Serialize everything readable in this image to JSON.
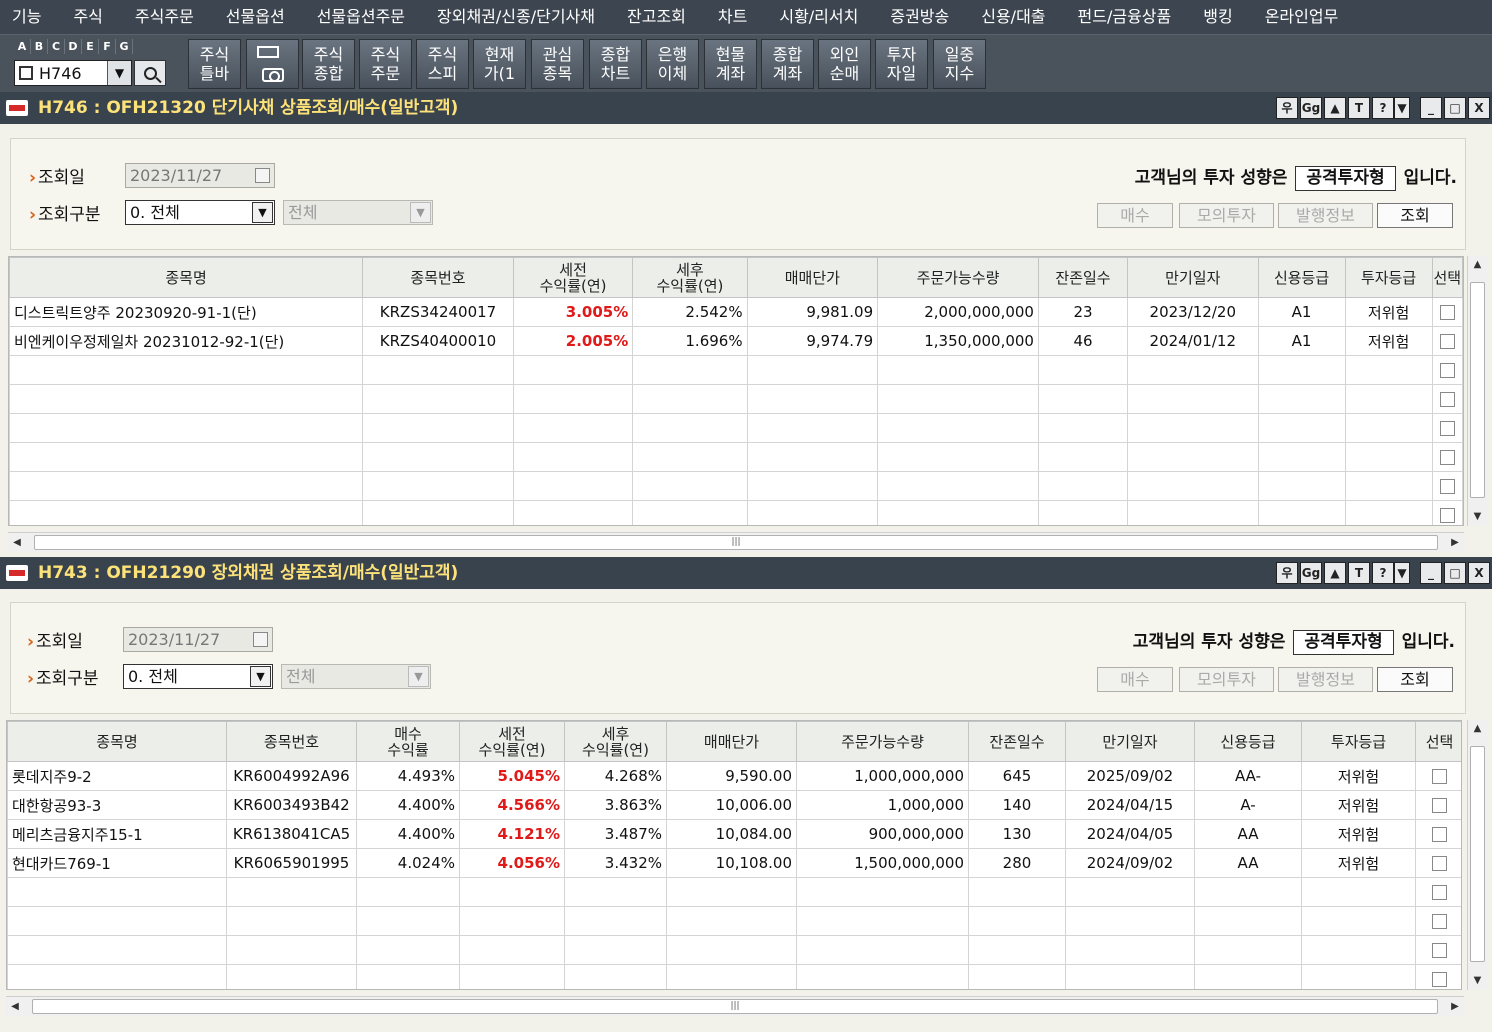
{
  "menu": [
    "기능",
    "주식",
    "주식주문",
    "선물옵션",
    "선물옵션주문",
    "장외채권/신종/단기사채",
    "잔고조회",
    "차트",
    "시황/리서치",
    "증권방송",
    "신용/대출",
    "펀드/금융상품",
    "뱅킹",
    "온라인업무"
  ],
  "toolbar": {
    "letters": [
      "A",
      "B",
      "C",
      "D",
      "E",
      "F",
      "G"
    ],
    "code": "H746",
    "buttons": [
      "주식\n틀바",
      "주식\n종합",
      "주식\n주문",
      "주식\n스피",
      "현재\n가(1",
      "관심\n종목",
      "종합\n차트",
      "은행\n이체",
      "현물\n계좌",
      "종합\n계좌",
      "외인\n순매",
      "투자\n자일",
      "일중\n지수"
    ]
  },
  "window_controls": [
    "우",
    "Gg",
    "▲",
    "T",
    "?",
    "▼",
    "_",
    "□",
    "X"
  ],
  "colors": {
    "menubar": "#3d4650",
    "title_text": "#fde27a",
    "highlight_red": "#e01919",
    "label_arrow": "#d9621a"
  },
  "win1": {
    "title": "H746 : OFH21320 단기사채 상품조회/매수(일반고객)",
    "query_date_label": "조회일",
    "query_date": "2023/11/27",
    "query_type_label": "조회구분",
    "query_type": "0. 전체",
    "query_sub": "전체",
    "invest_prefix": "고객님의 투자 성향은",
    "invest_type": "공격투자형",
    "invest_suffix": "입니다.",
    "buttons": [
      "매수",
      "모의투자",
      "발행정보",
      "조회"
    ],
    "headers": [
      "종목명",
      "종목번호",
      "세전\n수익률(연)",
      "세후\n수익률(연)",
      "매매단가",
      "주문가능수량",
      "잔존일수",
      "만기일자",
      "신용등급",
      "투자등급",
      "선택"
    ],
    "rows": [
      [
        "디스트릭트양주 20230920-91-1(단)",
        "KRZS34240017",
        "3.005%",
        "2.542%",
        "9,981.09",
        "2,000,000,000",
        "23",
        "2023/12/20",
        "A1",
        "저위험"
      ],
      [
        "비엔케이우정제일차 20231012-92-1(단)",
        "KRZS40400010",
        "2.005%",
        "1.696%",
        "9,974.79",
        "1,350,000,000",
        "46",
        "2024/01/12",
        "A1",
        "저위험"
      ]
    ],
    "total_rows": 8
  },
  "win2": {
    "title": "H743 : OFH21290 장외채권 상품조회/매수(일반고객)",
    "query_date_label": "조회일",
    "query_date": "2023/11/27",
    "query_type_label": "조회구분",
    "query_type": "0. 전체",
    "query_sub": "전체",
    "invest_prefix": "고객님의 투자 성향은",
    "invest_type": "공격투자형",
    "invest_suffix": "입니다.",
    "buttons": [
      "매수",
      "모의투자",
      "발행정보",
      "조회"
    ],
    "headers": [
      "종목명",
      "종목번호",
      "매수\n수익률",
      "세전\n수익률(연)",
      "세후\n수익률(연)",
      "매매단가",
      "주문가능수량",
      "잔존일수",
      "만기일자",
      "신용등급",
      "투자등급",
      "선택"
    ],
    "rows": [
      [
        "롯데지주9-2",
        "KR6004992A96",
        "4.493%",
        "5.045%",
        "4.268%",
        "9,590.00",
        "1,000,000,000",
        "645",
        "2025/09/02",
        "AA-",
        "저위험"
      ],
      [
        "대한항공93-3",
        "KR6003493B42",
        "4.400%",
        "4.566%",
        "3.863%",
        "10,006.00",
        "1,000,000",
        "140",
        "2024/04/15",
        "A-",
        "저위험"
      ],
      [
        "메리츠금융지주15-1",
        "KR6138041CA5",
        "4.400%",
        "4.121%",
        "3.487%",
        "10,084.00",
        "900,000,000",
        "130",
        "2024/04/05",
        "AA",
        "저위험"
      ],
      [
        "현대카드769-1",
        "KR6065901995",
        "4.024%",
        "4.056%",
        "3.432%",
        "10,108.00",
        "1,500,000,000",
        "280",
        "2024/09/02",
        "AA",
        "저위험"
      ]
    ],
    "total_rows": 8
  }
}
